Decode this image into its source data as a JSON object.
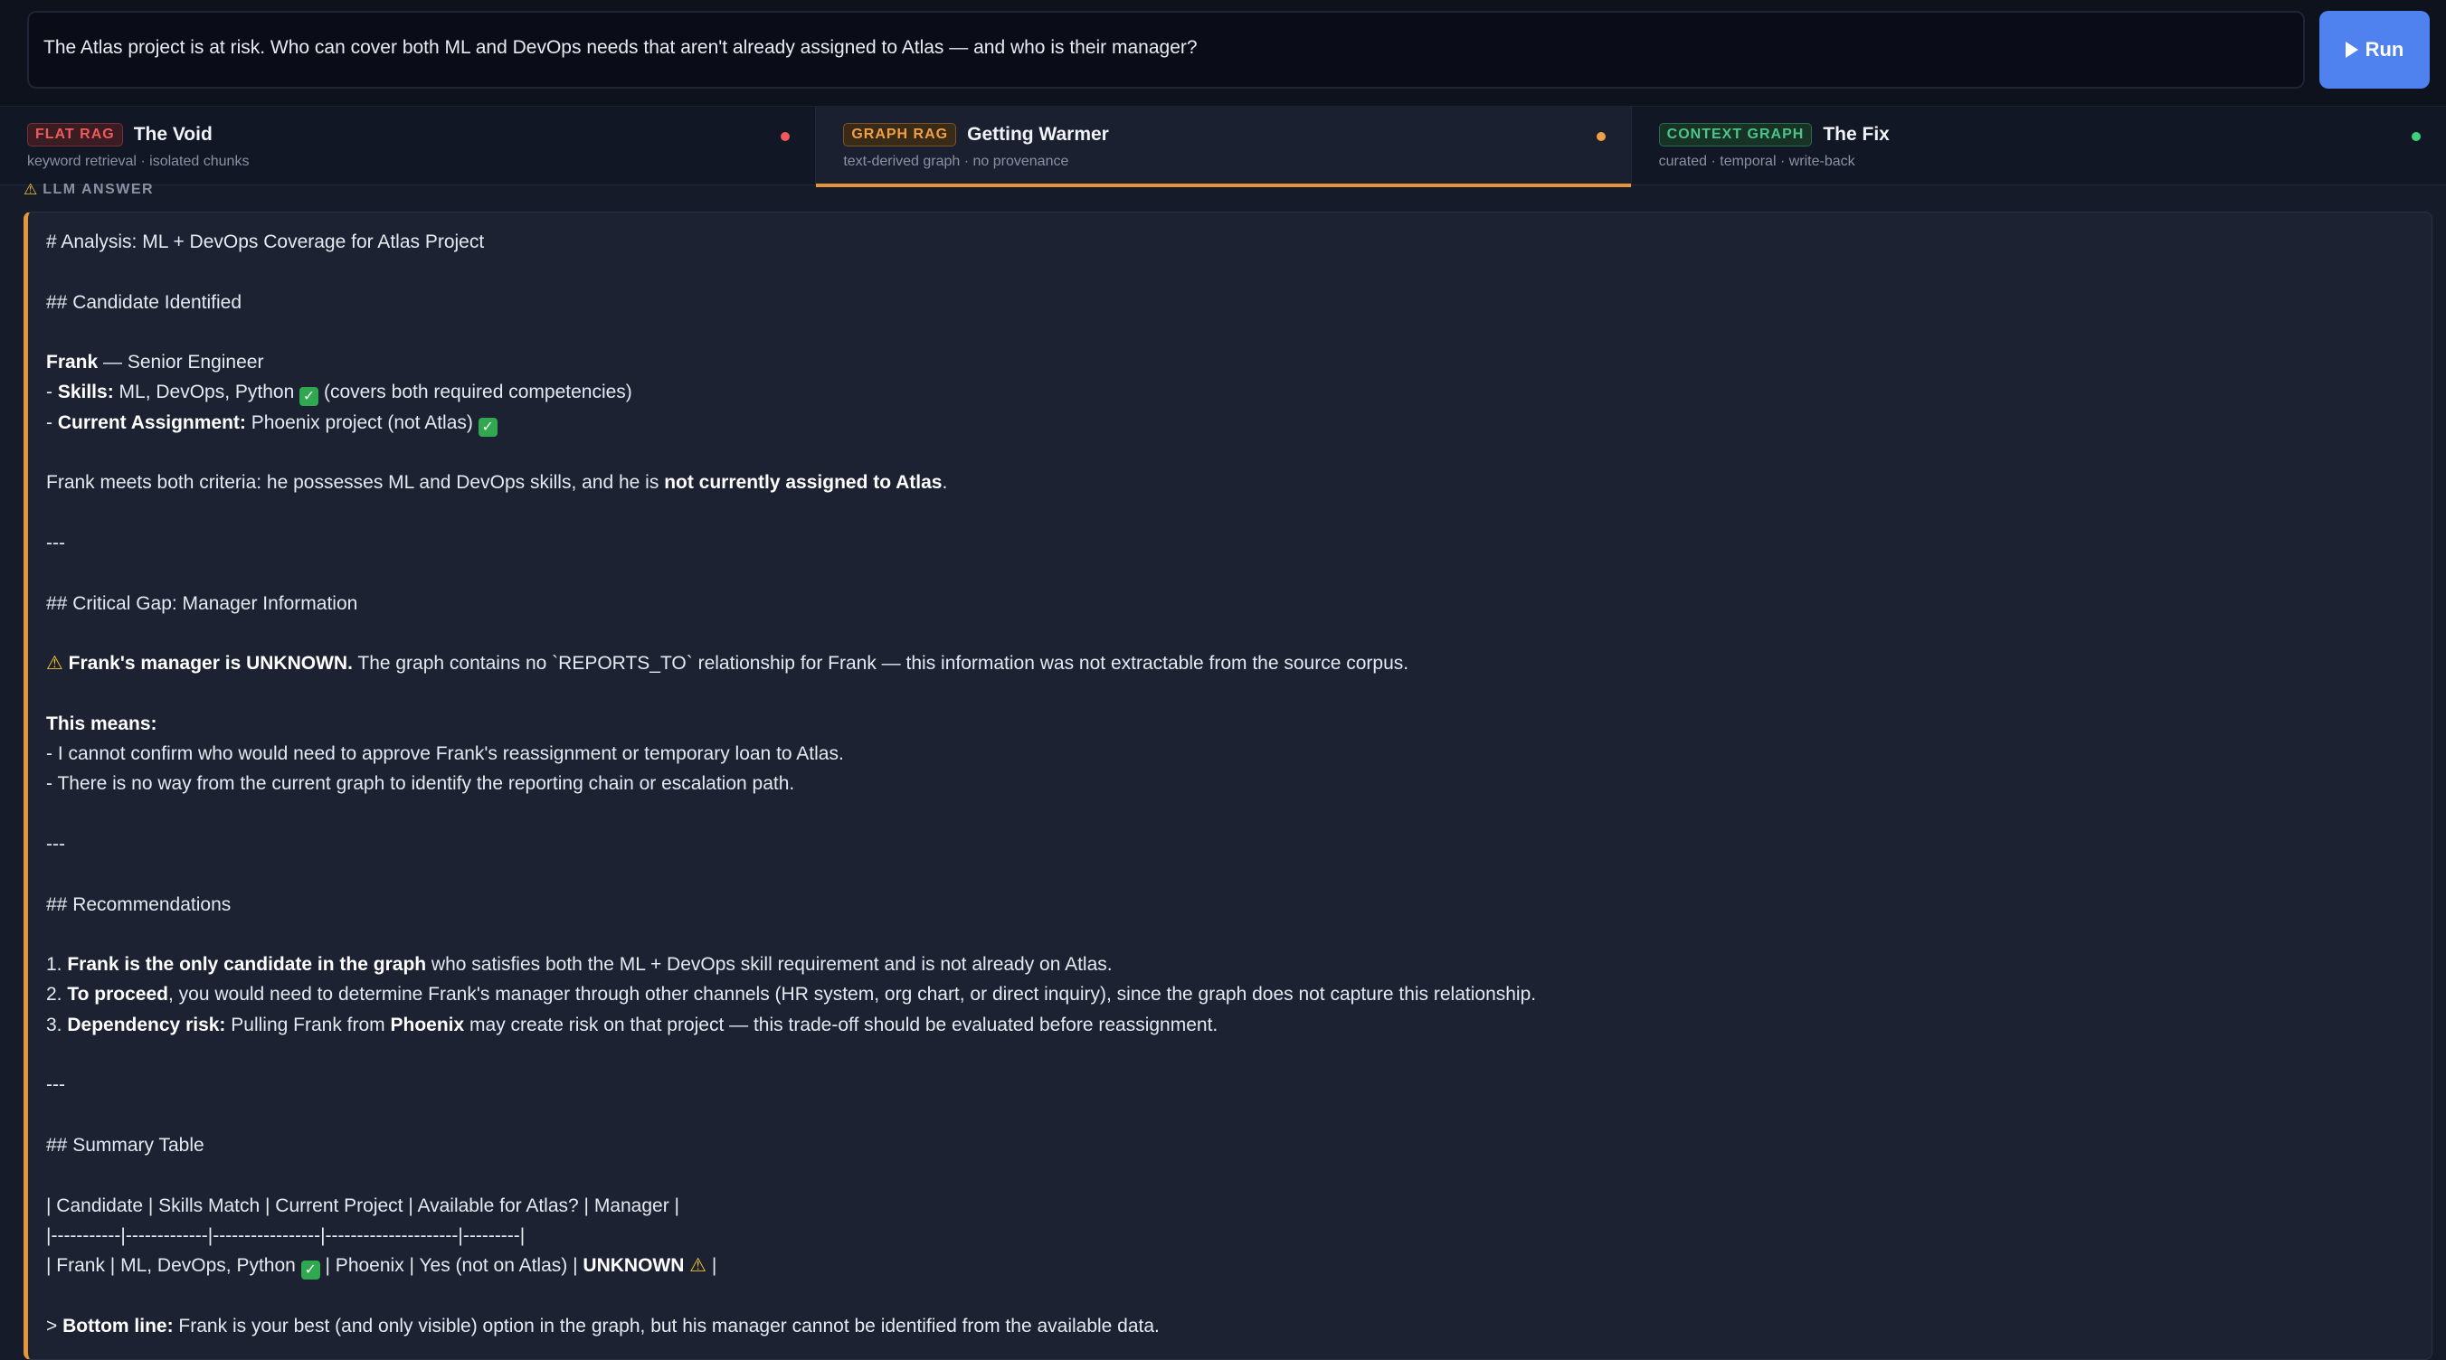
{
  "query": {
    "text": "The Atlas project is at risk. Who can cover both ML and DevOps needs that aren't already assigned to Atlas — and who is their manager?",
    "run_label": "Run"
  },
  "tabs": [
    {
      "badge": "FLAT RAG",
      "title": "The Void",
      "subtitle": "keyword retrieval · isolated chunks",
      "status_color": "#ef5b5b",
      "active": false
    },
    {
      "badge": "GRAPH RAG",
      "title": "Getting Warmer",
      "subtitle": "text-derived graph · no provenance",
      "status_color": "#f0a044",
      "active": true
    },
    {
      "badge": "CONTEXT GRAPH",
      "title": "The Fix",
      "subtitle": "curated · temporal · write-back",
      "status_color": "#3fd07f",
      "active": false
    }
  ],
  "answer": {
    "label": "LLM ANSWER",
    "h1": "# Analysis: ML + DevOps Coverage for Atlas Project",
    "candidate_heading": "## Candidate Identified",
    "frank_name": "Frank",
    "frank_role": " — Senior Engineer",
    "skills_prefix": "- ",
    "skills_label": "Skills:",
    "skills_value": " ML, DevOps, Python ",
    "skills_note": " (covers both required competencies)",
    "assignment_prefix": "- ",
    "assignment_label": "Current Assignment:",
    "assignment_value": " Phoenix project (not Atlas) ",
    "criteria_text": "Frank meets both criteria: he possesses ML and DevOps skills, and he is ",
    "criteria_bold": "not currently assigned to Atlas",
    "criteria_end": ".",
    "hr1": "---",
    "gap_heading": "## Critical Gap: Manager Information",
    "gap_bold": "Frank's manager is UNKNOWN.",
    "gap_text": " The graph contains no `REPORTS_TO` relationship for Frank — this information was not extractable from the source corpus.",
    "means_label": "This means:",
    "means_1": "- I cannot confirm who would need to approve Frank's reassignment or temporary loan to Atlas.",
    "means_2": "- There is no way from the current graph to identify the reporting chain or escalation path.",
    "hr2": "---",
    "rec_heading": "## Recommendations",
    "rec1_num": "1. ",
    "rec1_bold": "Frank is the only candidate in the graph",
    "rec1_text": " who satisfies both the ML + DevOps skill requirement and is not already on Atlas.",
    "rec2_num": "2. ",
    "rec2_bold": "To proceed",
    "rec2_text": ", you would need to determine Frank's manager through other channels (HR system, org chart, or direct inquiry), since the graph does not capture this relationship.",
    "rec3_num": "3. ",
    "rec3_bold": "Dependency risk:",
    "rec3_text": " Pulling Frank from ",
    "rec3_bold2": "Phoenix",
    "rec3_text2": " may create risk on that project — this trade-off should be evaluated before reassignment.",
    "hr3": "---",
    "table_heading": "## Summary Table",
    "table_header": "| Candidate | Skills Match | Current Project | Available for Atlas? | Manager |",
    "table_sep": "|-----------|-------------|-----------------|---------------------|---------|",
    "table_row_start": "| Frank | ML, DevOps, Python ",
    "table_row_mid": " | Phoenix | Yes (not on Atlas) | ",
    "table_row_bold": "UNKNOWN",
    "table_row_end": " |",
    "bottom_prefix": "> ",
    "bottom_bold": "Bottom line:",
    "bottom_text": " Frank is your best (and only visible) option in the graph, but his manager cannot be identified from the available data."
  },
  "icons": {
    "run": "play-icon",
    "answer_label": "warning-icon",
    "check": "check-mark-icon",
    "warning": "warning-icon"
  }
}
